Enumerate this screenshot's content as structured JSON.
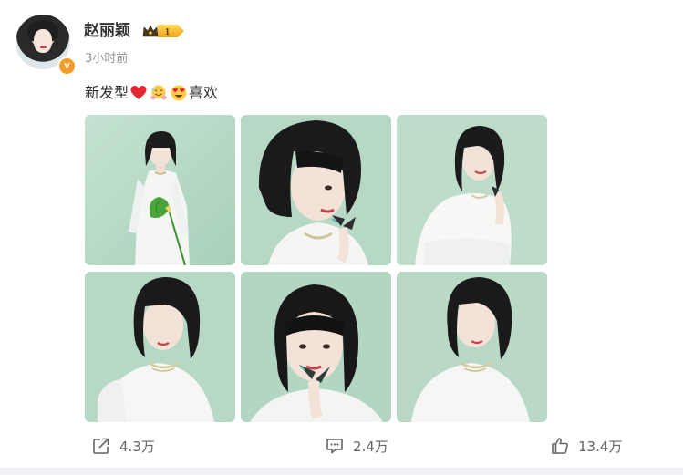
{
  "post": {
    "author": {
      "name": "赵丽颖",
      "verified_badge": "v",
      "member_level": "1"
    },
    "time": "3小时前",
    "text_prefix": "新发型",
    "text_suffix": "喜欢",
    "emojis": [
      "red-heart-emoji",
      "hugging-face-emoji",
      "heart-eyes-emoji"
    ],
    "images": [
      {
        "id": "photo-1",
        "pose": "full-body-with-flower"
      },
      {
        "id": "photo-2",
        "pose": "close-up-butterfly"
      },
      {
        "id": "photo-3",
        "pose": "leaning-smile"
      },
      {
        "id": "photo-4",
        "pose": "portrait-front"
      },
      {
        "id": "photo-5",
        "pose": "close-up-butterfly-front"
      },
      {
        "id": "photo-6",
        "pose": "portrait-tilt"
      }
    ]
  },
  "actions": {
    "repost_count": "4.3万",
    "comment_count": "2.4万",
    "like_count": "13.4万"
  },
  "colors": {
    "verified": "#f29c2a",
    "background_mint": "#b9d9c7",
    "text_primary": "#333333",
    "text_secondary": "#939393",
    "action_gray": "#666666"
  }
}
